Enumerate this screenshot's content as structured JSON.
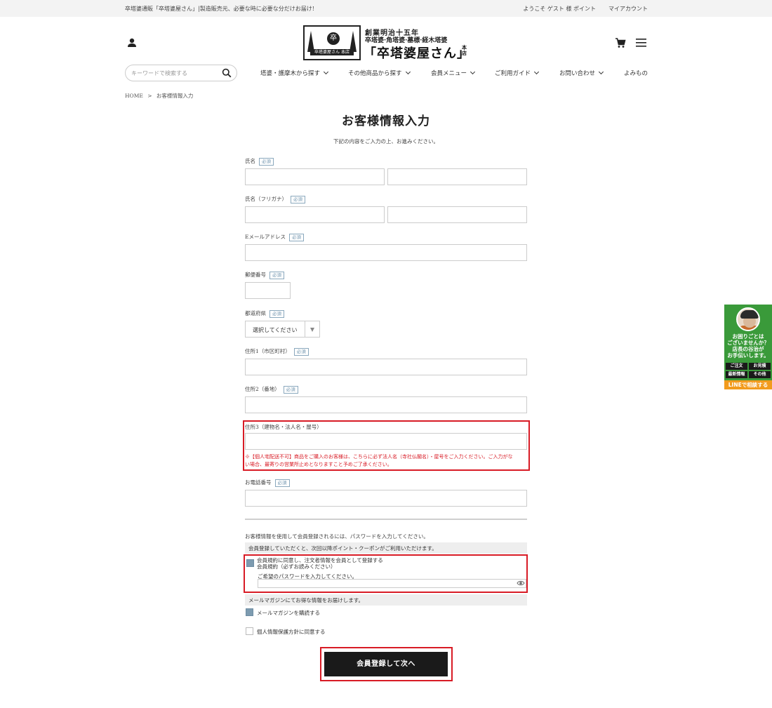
{
  "topbar": {
    "tagline": "卒塔婆通販「卒塔婆屋さん」|製造販売元、必要な時に必要な分だけお届け!",
    "welcome": "ようこそ ゲスト 様 ポイント",
    "my_account": "マイアカウント"
  },
  "logo": {
    "line1": "創業明治十五年",
    "line2": "卒塔婆·角塔婆·墓標·経木塔婆",
    "line3": "「卒塔婆屋さん」",
    "honten": "本店",
    "seal_char": "卒",
    "seal_band": "卒塔婆屋さん 本店"
  },
  "header": {
    "search_placeholder": "キーワードで検索する",
    "nav": [
      {
        "label": "塔婆・護摩木から探す"
      },
      {
        "label": "その他商品から探す"
      },
      {
        "label": "会員メニュー"
      },
      {
        "label": "ご利用ガイド"
      },
      {
        "label": "お問い合わせ"
      },
      {
        "label": "よみもの"
      }
    ]
  },
  "breadcrumb": {
    "home": "HOME",
    "sep": ">",
    "current": "お客様情報入力"
  },
  "page": {
    "title": "お客様情報入力",
    "subtitle": "下記の内容をご入力の上、お進みください。"
  },
  "form": {
    "required_badge": "必須",
    "name_label": "氏名",
    "kana_label": "氏名（フリガナ）",
    "email_label": "Eメールアドレス",
    "zip_label": "郵便番号",
    "pref_label": "都道府県",
    "pref_value": "選択してください",
    "addr1_label": "住所1（市区町村）",
    "addr2_label": "住所2（番地）",
    "addr3_label": "住所3（建物名・法人名・屋号）",
    "addr3_note_1": "※【個人宅配送不可】商品をご購入のお客様は、こちらに必ず法人名（寺社仏閣名）・屋号をご入力ください。ご入力がな",
    "addr3_note_2": "い場合、最寄りの営業所止めとなりますこと予めご了承ください。",
    "phone_label": "お電話番号"
  },
  "register": {
    "intro": "お客様情報を使用して会員登録されるには、パスワードを入力してください。",
    "bar1": "会員登録していただくと、次回以降ポイント・クーポンがご利用いただけます。",
    "agree_line1": "会員規約に同意し、注文者情報を会員として登録する",
    "agree_line2": "会員規約（必ずお読みください）",
    "password_prompt": "ご希望のパスワードを入力してください。",
    "bar2": "メールマガジンにてお得な情報をお届けします。",
    "newsletter": "メールマガジンを購読する",
    "privacy": "個人情報保護方針に同意する",
    "agree_checked": true,
    "newsletter_checked": true,
    "privacy_checked": false,
    "submit": "会員登録して次へ"
  },
  "banner": {
    "msg": "お困りごとは\nございませんか？\n店長の谷治が\nお手伝いします。",
    "cells": [
      "ご注文",
      "お見積",
      "最新情報",
      "その他"
    ],
    "line_button": "LINEで相談する"
  },
  "colors": {
    "accent_red": "#d81b25",
    "button_dark": "#1a1a1a",
    "badge_blue": "#6e93ad",
    "banner_green": "#3a9a3a",
    "banner_orange": "#f29b1d"
  }
}
